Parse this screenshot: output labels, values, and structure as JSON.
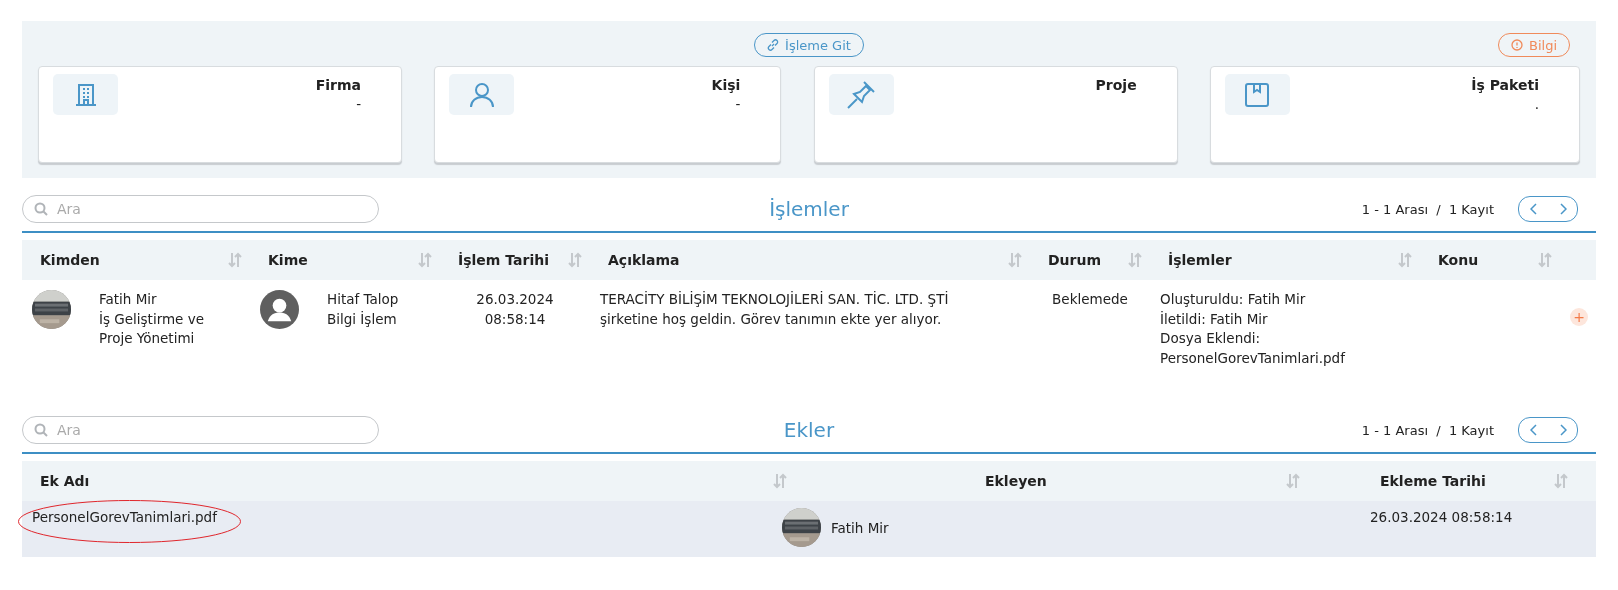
{
  "top_panel": {
    "go_button": "İşleme Git",
    "info_button": "Bilgi"
  },
  "cards": [
    {
      "kind": "building",
      "title": "Firma",
      "value": "-"
    },
    {
      "kind": "person",
      "title": "Kişi",
      "value": "-"
    },
    {
      "kind": "pin",
      "title": "Proje"
    },
    {
      "kind": "package",
      "title": "İş Paketi",
      "value": "."
    }
  ],
  "transactions": {
    "search": {
      "placeholder": "Ara"
    },
    "title": "İşlemler",
    "pagination": "1 - 1 Arası  /  1 Kayıt",
    "columns": [
      "Kimden",
      "Kime",
      "İşlem Tarihi",
      "Açıklama",
      "Durum",
      "İşlemler",
      "Konu"
    ],
    "rows": [
      {
        "from": {
          "name": "Fatih Mir",
          "department": "İş Geliştirme ve Proje Yönetimi"
        },
        "to": {
          "kind": "default",
          "name": "Hitaf Talop",
          "department": "Bilgi İşlem"
        },
        "date": [
          "26.03.2024",
          "08:58:14"
        ],
        "description": "TERACİTY BİLİŞİM TEKNOLOJİLERİ SAN. TİC. LTD. ŞTİ şirketine hoş geldin. Görev tanımın ekte yer alıyor.",
        "status": "Beklemede",
        "actions": [
          "Oluşturuldu: Fatih Mir",
          "İletildi: Fatih Mir",
          "Dosya Eklendi: PersonelGorevTanimlari.pdf"
        ],
        "add_button": "+"
      }
    ]
  },
  "attachments": {
    "search": {
      "placeholder": "Ara"
    },
    "title": "Ekler",
    "pagination": "1 - 1 Arası  /  1 Kayıt",
    "columns": [
      "Ek Adı",
      "Ekleyen",
      "Ekleme Tarihi"
    ],
    "rows": [
      {
        "file": "PersonelGorevTanimlari.pdf",
        "circled": true,
        "added_by": {
          "name": "Fatih Mir"
        },
        "date": "26.03.2024 08:58:14"
      }
    ]
  }
}
